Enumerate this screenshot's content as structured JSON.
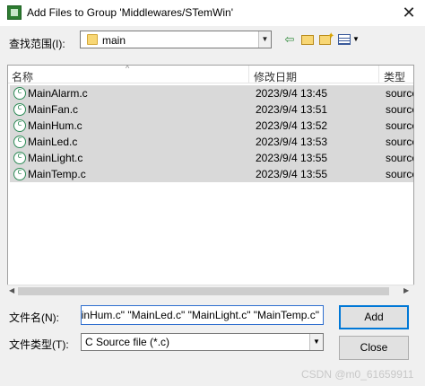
{
  "window": {
    "title": "Add Files to Group 'Middlewares/STemWin'",
    "close_glyph": "✕"
  },
  "toolbar": {
    "look_in_label": "查找范围(I):",
    "look_in_value": "main",
    "back_glyph": "⇦",
    "dropdown_glyph": "▼"
  },
  "list": {
    "columns": {
      "name": "名称",
      "date": "修改日期",
      "type": "类型"
    },
    "sort_glyph": "^",
    "files": [
      {
        "name": "MainAlarm.c",
        "date": "2023/9/4 13:45",
        "type": "source"
      },
      {
        "name": "MainFan.c",
        "date": "2023/9/4 13:51",
        "type": "source"
      },
      {
        "name": "MainHum.c",
        "date": "2023/9/4 13:52",
        "type": "source"
      },
      {
        "name": "MainLed.c",
        "date": "2023/9/4 13:53",
        "type": "source"
      },
      {
        "name": "MainLight.c",
        "date": "2023/9/4 13:55",
        "type": "source"
      },
      {
        "name": "MainTemp.c",
        "date": "2023/9/4 13:55",
        "type": "source"
      }
    ],
    "scroll_left_glyph": "◀",
    "scroll_right_glyph": "▶"
  },
  "form": {
    "file_name_label": "文件名(N):",
    "file_name_value": "inHum.c\" \"MainLed.c\" \"MainLight.c\" \"MainTemp.c\"",
    "file_type_label": "文件类型(T):",
    "file_type_value": "C Source file (*.c)"
  },
  "buttons": {
    "add": "Add",
    "close": "Close"
  },
  "watermark": "CSDN @m0_61659911"
}
